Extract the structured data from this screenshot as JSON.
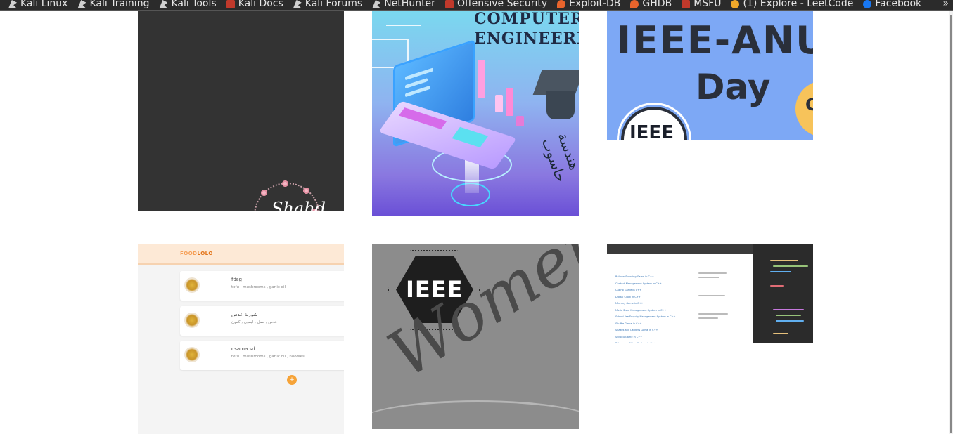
{
  "bookmarks": {
    "items": [
      {
        "label": "Kali Linux",
        "icon": "kali-dragon-icon"
      },
      {
        "label": "Kali Training",
        "icon": "kali-dragon-icon"
      },
      {
        "label": "Kali Tools",
        "icon": "kali-dragon-icon"
      },
      {
        "label": "Kali Docs",
        "icon": "kali-docs-icon"
      },
      {
        "label": "Kali Forums",
        "icon": "kali-dragon-icon"
      },
      {
        "label": "NetHunter",
        "icon": "kali-dragon-icon"
      },
      {
        "label": "Offensive Security",
        "icon": "offsec-icon"
      },
      {
        "label": "Exploit-DB",
        "icon": "exploitdb-icon"
      },
      {
        "label": "GHDB",
        "icon": "exploitdb-icon"
      },
      {
        "label": "MSFU",
        "icon": "offsec-icon"
      },
      {
        "label": "(1) Explore - LeetCode",
        "icon": "leetcode-icon"
      },
      {
        "label": "Facebook",
        "icon": "facebook-icon"
      }
    ],
    "overflow": "»"
  },
  "gallery": {
    "tile1": {
      "script_text": "Shahd"
    },
    "tile2": {
      "title_line1": "COMPUTER",
      "title_line2": "ENGINEERIN",
      "arabic_text": "هندسة حاسوب"
    },
    "tile3": {
      "title": "IEEE-ANUS",
      "subtitle": "Day",
      "logo_text": "IEEE",
      "circle_text": "C"
    },
    "tile4": {
      "brand_prefix": "FOOD",
      "brand_suffix": "LOLO",
      "items": [
        {
          "name": "fdsg",
          "desc": "tofu , mushrooms , garlic oil"
        },
        {
          "name": "شوربة عدس",
          "desc": "عدس , بصل , ليمون , كمون"
        },
        {
          "name": "osama sd",
          "desc": "tofu , mushrooms , garlic oil , noodles"
        }
      ],
      "fab_label": "+"
    },
    "tile5": {
      "logo_text": "IEEE",
      "script_text": "Women day"
    },
    "tile6": {
      "list": [
        "Balloon Shooting Game in C++",
        "Contact Management System in C++",
        "Casino Game in C++",
        "Digital Clock in C++",
        "Memory Game in C++",
        "Music Store Management System in C++",
        "School Fee Enquiry Management System in C++",
        "Shuffle Game in C++",
        "Snakes and Ladders Game in C++",
        "Sudoku Game in C++",
        "Telephone Billing System in C++"
      ]
    }
  },
  "colors": {
    "bookmarks_bg": "#2b2b2b",
    "tile2_bg_top": "#7ad8ef",
    "tile3_bg": "#7da8f5",
    "foodlolo_accent": "#f6a338"
  }
}
